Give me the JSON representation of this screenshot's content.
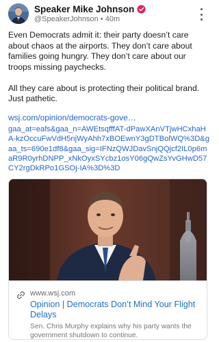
{
  "author": {
    "display_name": "Speaker Mike Johnson",
    "handle": "@SpeakerJohnson",
    "separator": "•",
    "age": "40m",
    "verified": true,
    "avatar_icon": "avatar-portrait-icon",
    "verified_icon": "verified-badge-icon",
    "verified_color": "#e0245e"
  },
  "post": {
    "paragraphs": [
      "Even Democrats admit it: their party doesn’t care about chaos at the airports. They don’t care about families going hungry. They don’t care about our troops missing paychecks.",
      "All they care about is protecting their political brand. Just pathetic."
    ],
    "link_display": "wsj.com/opinion/democrats-gove…",
    "link_rest": "gaa_at=eafs&gaa_n=AWEtsqfffAT-dPawXAnVTjwHCxhaHA-kzOccuFwVdH5njWyAhh7xBOEwnY3gDTBolWQ%3D&gaa_ts=690e1df8&gaa_sig=IFNzQWJDavSnjQQjcf2IL0p6maR9R0yrhDNPP_xNkOyxSYcbz1osY06gQwZsYvGHwD57CY2rgDkRPo1GSOj-IA%3D%3D",
    "more_icon": "more-vertical-icon",
    "link_color": "#2563c9"
  },
  "card": {
    "domain": "www.wsj.com",
    "title": "Opinion | Democrats Don’t Mind Your Flight Delays",
    "description": "Sen. Chris Murphy explains why his party wants the government shutdown to continue.",
    "link_icon": "link-icon",
    "title_color": "#1f6fbf"
  }
}
